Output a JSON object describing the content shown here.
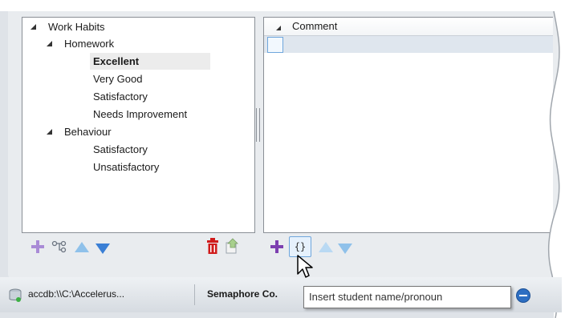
{
  "tree": {
    "items": [
      {
        "label": "Work Habits",
        "level": 0,
        "expanded": true
      },
      {
        "label": "Homework",
        "level": 1,
        "expanded": true
      },
      {
        "label": "Excellent",
        "level": 2,
        "selected": true
      },
      {
        "label": "Very Good",
        "level": 2
      },
      {
        "label": "Satisfactory",
        "level": 2
      },
      {
        "label": "Needs Improvement",
        "level": 2
      },
      {
        "label": "Behaviour",
        "level": 1,
        "expanded": true
      },
      {
        "label": "Satisfactory",
        "level": 2
      },
      {
        "label": "Unsatisfactory",
        "level": 2
      }
    ]
  },
  "grid": {
    "column_header": "Comment"
  },
  "left_toolbar": {
    "icons": [
      "add-plus-icon",
      "link-nodes-icon",
      "move-up-icon",
      "move-down-icon",
      "delete-trash-icon",
      "export-icon"
    ]
  },
  "right_toolbar": {
    "icons": [
      "add-plus-icon",
      "insert-braces-icon",
      "move-up-icon",
      "move-down-icon"
    ],
    "braces_glyph": "{}"
  },
  "tooltip": {
    "text": "Insert student name/pronoun"
  },
  "statusbar": {
    "connection": "accdb:\\\\C:\\Accelerus...",
    "school": "Semaphore Co."
  },
  "colors": {
    "plus": "#7d3fb0",
    "arrow_blue": "#3a7fd5",
    "arrow_light": "#8fc1ea",
    "trash": "#d01b1b"
  }
}
